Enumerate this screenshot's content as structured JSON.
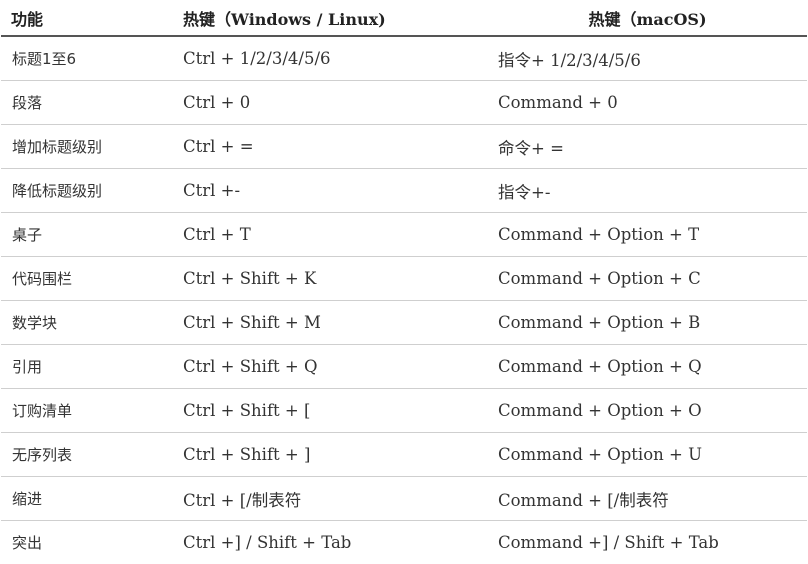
{
  "table": {
    "headers": {
      "function": "功能",
      "windows_linux": "热键（Windows / Linux)",
      "macos": "热键（macOS)"
    },
    "rows": [
      {
        "function": "标题1至6",
        "windows_linux": "Ctrl + 1/2/3/4/5/6",
        "macos": "指令+ 1/2/3/4/5/6"
      },
      {
        "function": "段落",
        "windows_linux": "Ctrl + 0",
        "macos": "Command + 0"
      },
      {
        "function": "增加标题级别",
        "windows_linux": "Ctrl + =",
        "macos": "命令+ ="
      },
      {
        "function": "降低标题级别",
        "windows_linux": "Ctrl +-",
        "macos": "指令+-"
      },
      {
        "function": "桌子",
        "windows_linux": "Ctrl + T",
        "macos": "Command + Option + T"
      },
      {
        "function": "代码围栏",
        "windows_linux": "Ctrl + Shift + K",
        "macos": "Command + Option + C"
      },
      {
        "function": "数学块",
        "windows_linux": "Ctrl + Shift + M",
        "macos": "Command + Option + B"
      },
      {
        "function": "引用",
        "windows_linux": "Ctrl + Shift + Q",
        "macos": "Command + Option + Q"
      },
      {
        "function": "订购清单",
        "windows_linux": "Ctrl + Shift + [",
        "macos": "Command + Option + O"
      },
      {
        "function": "无序列表",
        "windows_linux": "Ctrl + Shift + ]",
        "macos": "Command + Option + U"
      },
      {
        "function": "缩进",
        "windows_linux": "Ctrl + [/制表符",
        "macos": "Command + [/制表符"
      },
      {
        "function": "突出",
        "windows_linux": "Ctrl +] / Shift + Tab",
        "macos": "Command +] / Shift + Tab"
      }
    ]
  }
}
